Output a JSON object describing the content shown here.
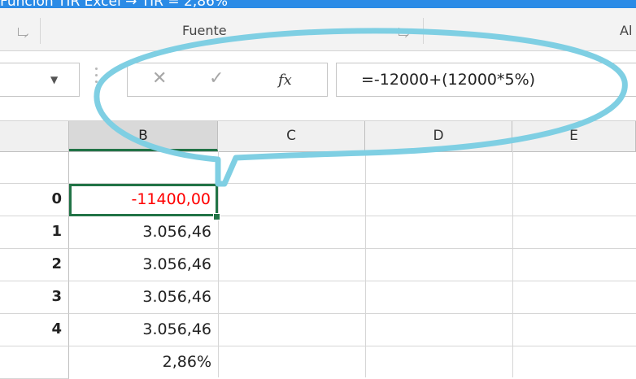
{
  "title_bar": {
    "text": "Función TIR Excel → TIR = 2,86%"
  },
  "ribbon": {
    "groups": [
      {
        "label": "Fuente"
      },
      {
        "label": "Al"
      }
    ]
  },
  "formula_bar": {
    "name_box_value": "",
    "cancel_glyph": "✕",
    "enter_glyph": "✓",
    "fx_label": "fx",
    "formula": "=-12000+(12000*5%)"
  },
  "columns": [
    "B",
    "C",
    "D",
    "E"
  ],
  "rows": [
    {
      "header": "",
      "value": ""
    },
    {
      "header": "0",
      "value": "-11400,00"
    },
    {
      "header": "1",
      "value": "3.056,46"
    },
    {
      "header": "2",
      "value": "3.056,46"
    },
    {
      "header": "3",
      "value": "3.056,46"
    },
    {
      "header": "4",
      "value": "3.056,46"
    },
    {
      "header": "",
      "value": "2,86%"
    }
  ],
  "colors": {
    "accent": "#217346",
    "negative": "#ff0000",
    "callout": "#7fcfe3",
    "title_bar": "#2b8be6"
  }
}
